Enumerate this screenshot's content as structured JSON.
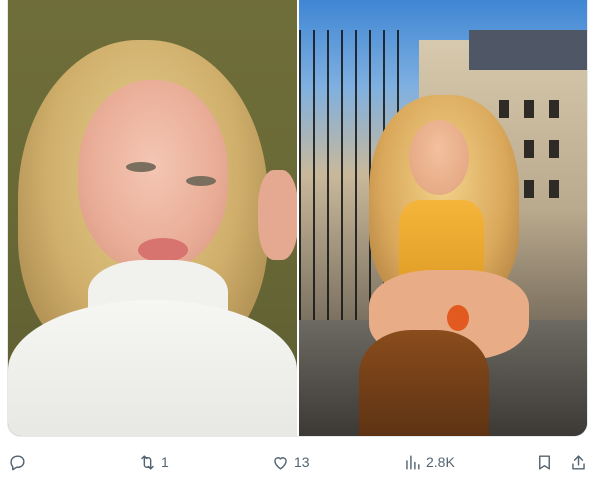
{
  "tweet": {
    "media": [
      {
        "alt_name": "selfie-photo"
      },
      {
        "alt_name": "balcony-photo"
      }
    ],
    "actions": {
      "reply": {
        "icon": "reply-icon",
        "count": ""
      },
      "retweet": {
        "icon": "retweet-icon",
        "count": "1"
      },
      "like": {
        "icon": "heart-icon",
        "count": "13"
      },
      "views": {
        "icon": "views-icon",
        "count": "2.8K"
      },
      "bookmark": {
        "icon": "bookmark-icon",
        "count": ""
      },
      "share": {
        "icon": "share-icon",
        "count": ""
      }
    }
  },
  "colors": {
    "icon": "#536471",
    "border": "#e6e9ec",
    "background": "#ffffff"
  }
}
